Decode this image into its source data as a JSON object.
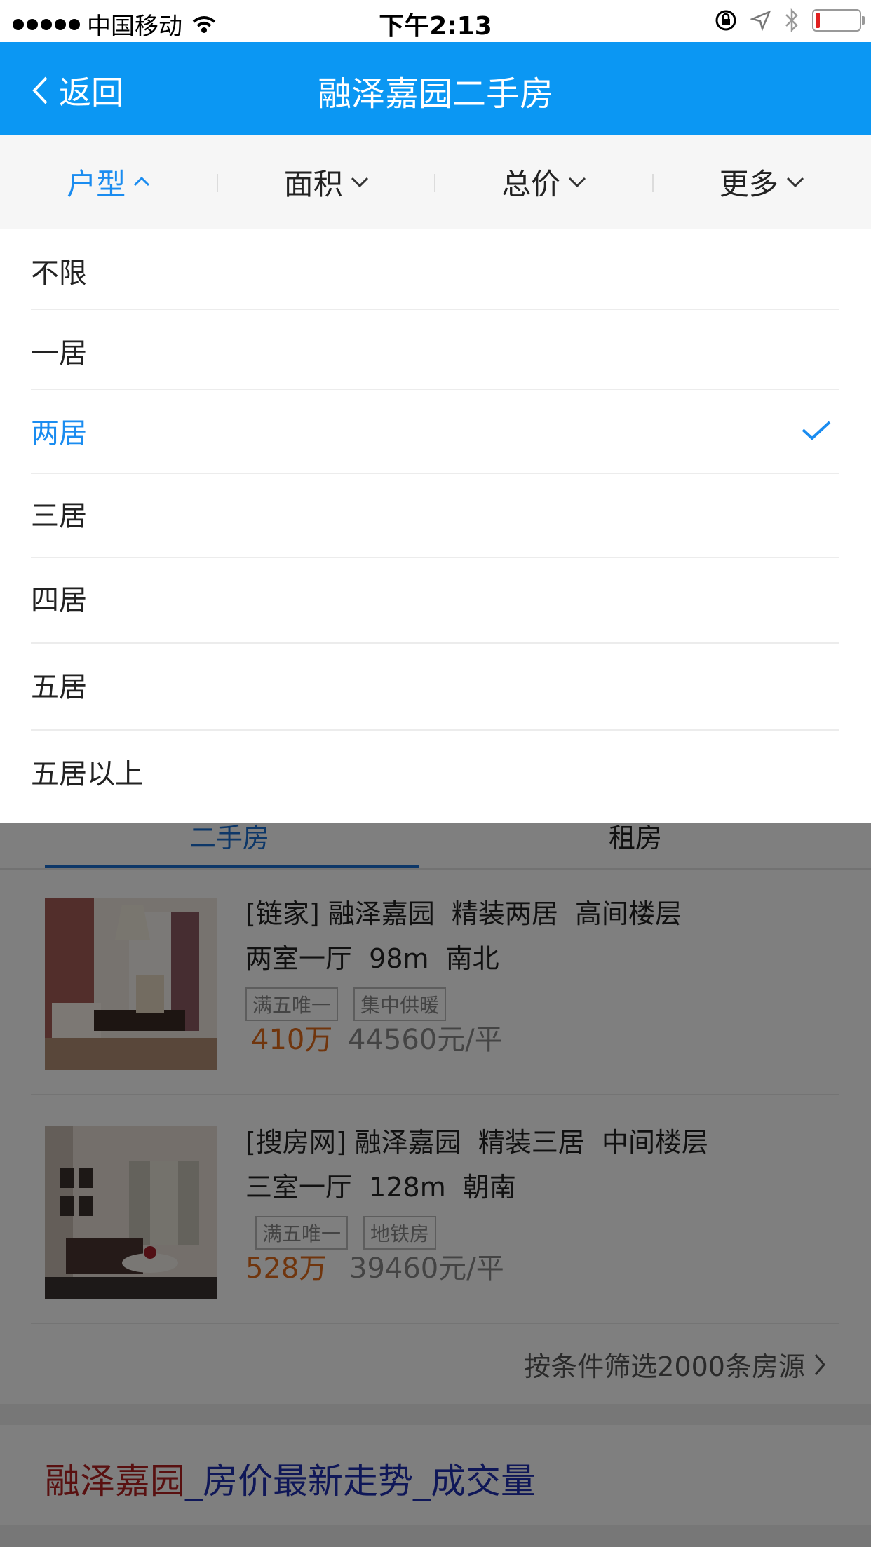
{
  "status_bar": {
    "carrier": "中国移动",
    "time": "下午2:13"
  },
  "nav": {
    "back_label": "返回",
    "title": "融泽嘉园二手房"
  },
  "filters": [
    {
      "label": "户型",
      "active": true
    },
    {
      "label": "面积",
      "active": false
    },
    {
      "label": "总价",
      "active": false
    },
    {
      "label": "更多",
      "active": false
    }
  ],
  "dropdown": {
    "options": [
      "不限",
      "一居",
      "两居",
      "三居",
      "四居",
      "五居",
      "五居以上"
    ],
    "selected": "两居"
  },
  "content_tabs": {
    "sale": "二手房",
    "rent": "租房"
  },
  "listings": [
    {
      "title": "[链家] 融泽嘉园  精装两居  高间楼层",
      "sub": "两室一厅  98m  南北",
      "tags": [
        "满五唯一",
        "集中供暖"
      ],
      "price": "410万",
      "unit_price": "44560元/平"
    },
    {
      "title": "[搜房网] 融泽嘉园  精装三居  中间楼层",
      "sub": "三室一厅  128m  朝南",
      "tags": [
        "满五唯一",
        "地铁房"
      ],
      "price": "528万",
      "unit_price": "39460元/平"
    }
  ],
  "more_link": "按条件筛选2000条房源",
  "trend": {
    "brand": "融泽嘉园",
    "rest": "_房价最新走势_成交量"
  },
  "colors": {
    "nav_blue": "#0b97f3",
    "active_blue": "#1a8cf0",
    "price_orange": "#e06a1a"
  }
}
